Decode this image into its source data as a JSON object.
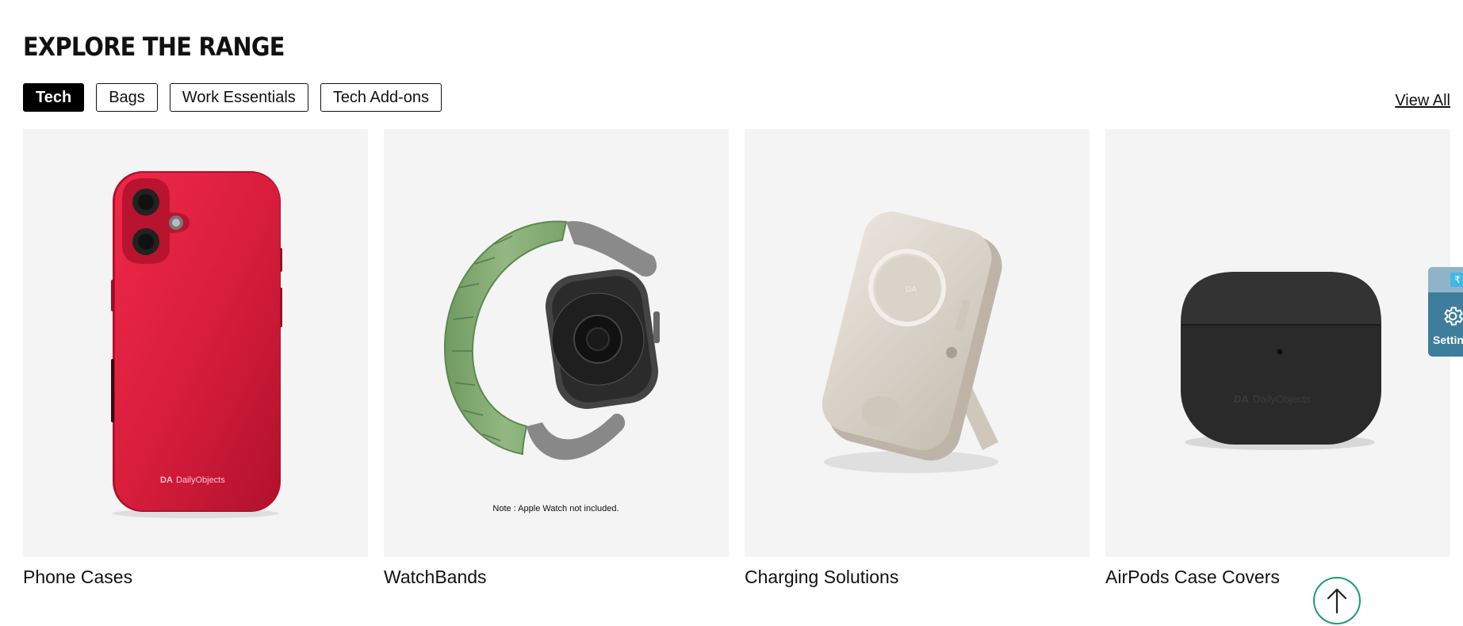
{
  "section": {
    "title": "EXPLORE THE RANGE",
    "view_all": "View All"
  },
  "tabs": [
    {
      "label": "Tech",
      "active": true
    },
    {
      "label": "Bags",
      "active": false
    },
    {
      "label": "Work Essentials",
      "active": false
    },
    {
      "label": "Tech Add-ons",
      "active": false
    }
  ],
  "cards": [
    {
      "title": "Phone Cases",
      "brand_mark": "DailyObjects",
      "brand_logo": "DA"
    },
    {
      "title": "WatchBands",
      "note": "Note : Apple Watch not included."
    },
    {
      "title": "Charging Solutions"
    },
    {
      "title": "AirPods Case Covers",
      "brand_mark": "DailyObjects",
      "brand_logo": "DA"
    }
  ],
  "settings_widget": {
    "label": "Settings",
    "currency_symbol": "₹",
    "icon": "gear-icon"
  },
  "scroll_top": {
    "icon": "arrow-up-icon"
  },
  "colors": {
    "phone_case": "#d81e3c",
    "watchband": "#8db07a",
    "charger": "#d8d1c7",
    "airpods_case": "#2a2a2a",
    "settings_bg": "#3f7d9c",
    "scroll_ring": "#1e9a74"
  }
}
